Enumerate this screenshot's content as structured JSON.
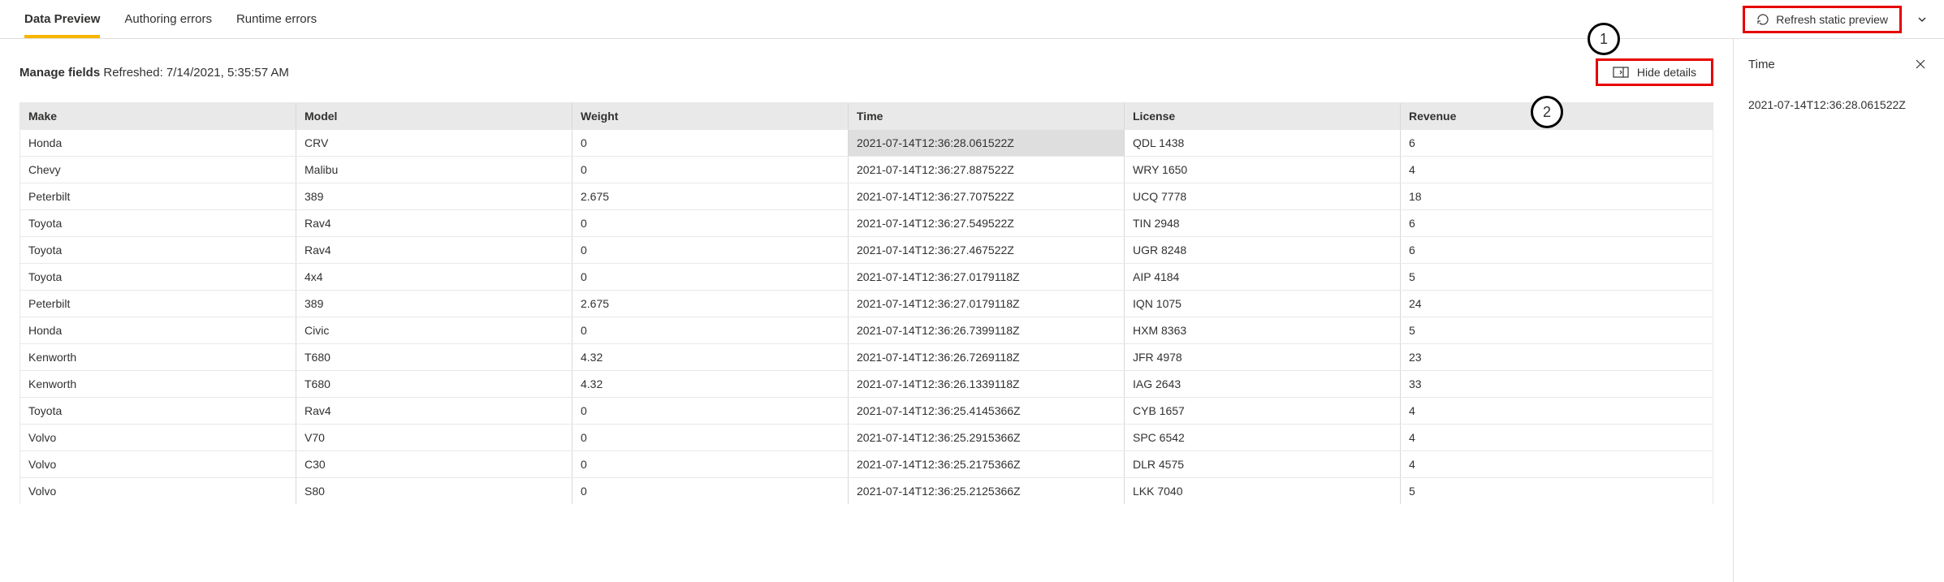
{
  "tabs": {
    "data_preview": "Data Preview",
    "authoring_errors": "Authoring errors",
    "runtime_errors": "Runtime errors"
  },
  "top": {
    "refresh_label": "Refresh static preview"
  },
  "header": {
    "manage_fields": "Manage fields",
    "refreshed_prefix": "Refreshed: ",
    "refreshed_time": "7/14/2021, 5:35:57 AM",
    "hide_details": "Hide details"
  },
  "callouts": {
    "one": "1",
    "two": "2"
  },
  "columns": {
    "make": "Make",
    "model": "Model",
    "weight": "Weight",
    "time": "Time",
    "license": "License",
    "revenue": "Revenue"
  },
  "rows": [
    {
      "make": "Honda",
      "model": "CRV",
      "weight": "0",
      "time": "2021-07-14T12:36:28.061522Z",
      "license": "QDL 1438",
      "revenue": "6",
      "selected": true
    },
    {
      "make": "Chevy",
      "model": "Malibu",
      "weight": "0",
      "time": "2021-07-14T12:36:27.887522Z",
      "license": "WRY 1650",
      "revenue": "4"
    },
    {
      "make": "Peterbilt",
      "model": "389",
      "weight": "2.675",
      "time": "2021-07-14T12:36:27.707522Z",
      "license": "UCQ 7778",
      "revenue": "18"
    },
    {
      "make": "Toyota",
      "model": "Rav4",
      "weight": "0",
      "time": "2021-07-14T12:36:27.549522Z",
      "license": "TIN 2948",
      "revenue": "6"
    },
    {
      "make": "Toyota",
      "model": "Rav4",
      "weight": "0",
      "time": "2021-07-14T12:36:27.467522Z",
      "license": "UGR 8248",
      "revenue": "6"
    },
    {
      "make": "Toyota",
      "model": "4x4",
      "weight": "0",
      "time": "2021-07-14T12:36:27.0179118Z",
      "license": "AIP 4184",
      "revenue": "5"
    },
    {
      "make": "Peterbilt",
      "model": "389",
      "weight": "2.675",
      "time": "2021-07-14T12:36:27.0179118Z",
      "license": "IQN 1075",
      "revenue": "24"
    },
    {
      "make": "Honda",
      "model": "Civic",
      "weight": "0",
      "time": "2021-07-14T12:36:26.7399118Z",
      "license": "HXM 8363",
      "revenue": "5"
    },
    {
      "make": "Kenworth",
      "model": "T680",
      "weight": "4.32",
      "time": "2021-07-14T12:36:26.7269118Z",
      "license": "JFR 4978",
      "revenue": "23"
    },
    {
      "make": "Kenworth",
      "model": "T680",
      "weight": "4.32",
      "time": "2021-07-14T12:36:26.1339118Z",
      "license": "IAG 2643",
      "revenue": "33"
    },
    {
      "make": "Toyota",
      "model": "Rav4",
      "weight": "0",
      "time": "2021-07-14T12:36:25.4145366Z",
      "license": "CYB 1657",
      "revenue": "4"
    },
    {
      "make": "Volvo",
      "model": "V70",
      "weight": "0",
      "time": "2021-07-14T12:36:25.2915366Z",
      "license": "SPC 6542",
      "revenue": "4"
    },
    {
      "make": "Volvo",
      "model": "C30",
      "weight": "0",
      "time": "2021-07-14T12:36:25.2175366Z",
      "license": "DLR 4575",
      "revenue": "4"
    },
    {
      "make": "Volvo",
      "model": "S80",
      "weight": "0",
      "time": "2021-07-14T12:36:25.2125366Z",
      "license": "LKK 7040",
      "revenue": "5"
    }
  ],
  "detail": {
    "title": "Time",
    "value": "2021-07-14T12:36:28.061522Z"
  }
}
